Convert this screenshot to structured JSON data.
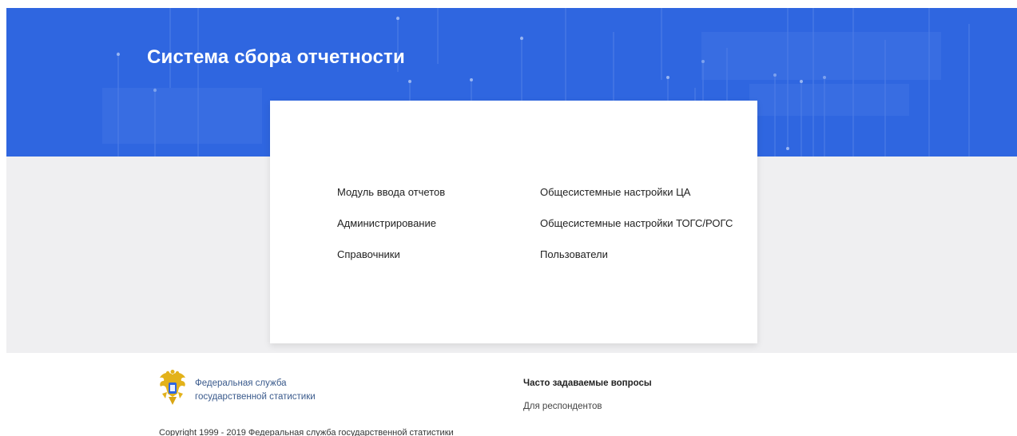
{
  "header": {
    "title": "Система сбора отчетности"
  },
  "menu": {
    "left": [
      "Модуль ввода отчетов",
      "Администрирование",
      "Справочники"
    ],
    "right": [
      "Общесистемные настройки ЦА",
      "Общесистемные настройки ТОГС/РОГС",
      "Пользователи"
    ]
  },
  "footer": {
    "logo_icon": "double-headed-eagle-emblem-icon",
    "org_line1": "Федеральная служба",
    "org_line2": "государственной статистики",
    "faq_title": "Часто задаваемые вопросы",
    "faq_link": "Для респондентов",
    "copyright": "Copyright 1999 - 2019 Федеральная служба государственной статистики"
  },
  "colors": {
    "hero_blue": "#2f66e0",
    "band_gray": "#efeff1",
    "org_text": "#3a5a8c"
  }
}
